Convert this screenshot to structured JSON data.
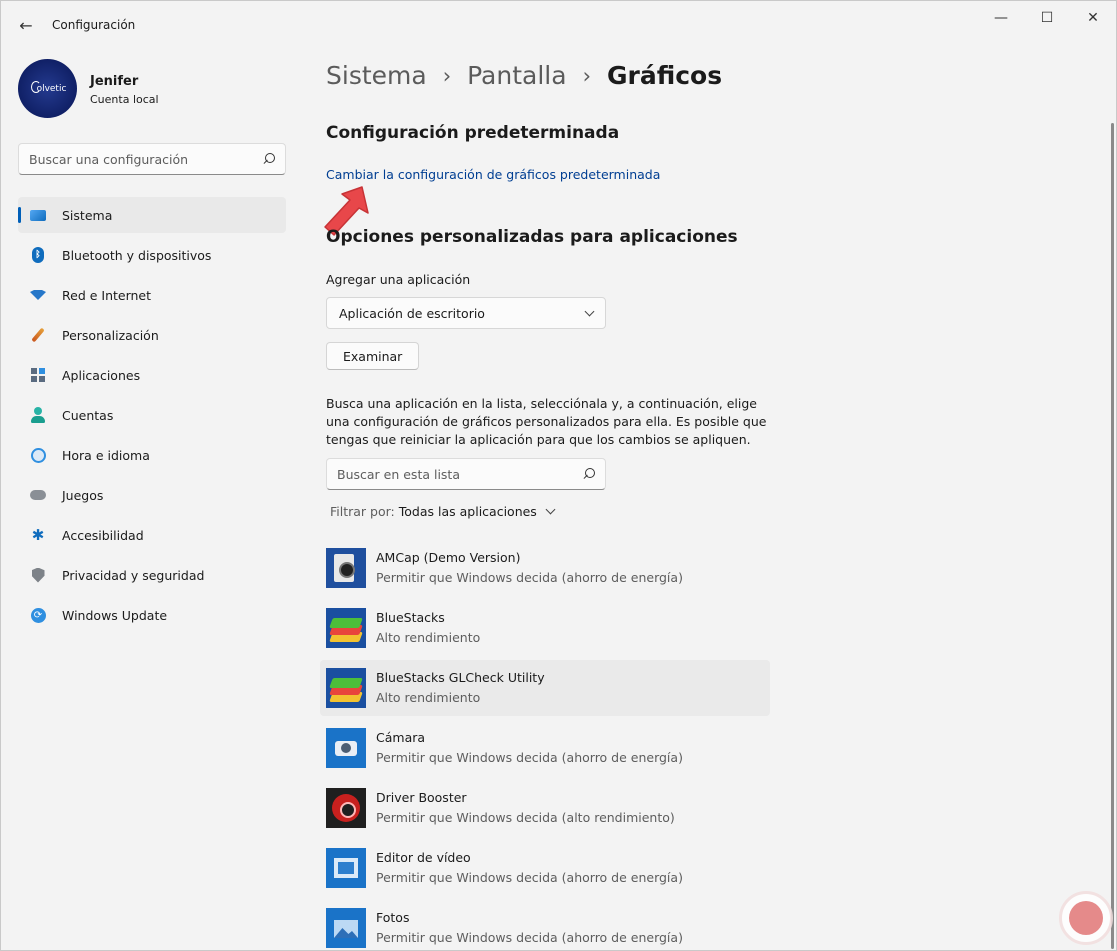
{
  "window": {
    "title": "Configuración",
    "back_icon": "arrow-left-icon",
    "controls": {
      "minimize": "—",
      "maximize": "☐",
      "close": "✕"
    }
  },
  "profile": {
    "name": "Jenifer",
    "subtitle": "Cuenta local",
    "avatar_text": "olvetic"
  },
  "sidebar": {
    "search_placeholder": "Buscar una configuración",
    "items": [
      {
        "label": "Sistema",
        "icon": "system-icon",
        "active": true
      },
      {
        "label": "Bluetooth y dispositivos",
        "icon": "bluetooth-icon"
      },
      {
        "label": "Red e Internet",
        "icon": "wifi-icon"
      },
      {
        "label": "Personalización",
        "icon": "brush-icon"
      },
      {
        "label": "Aplicaciones",
        "icon": "apps-icon"
      },
      {
        "label": "Cuentas",
        "icon": "user-icon"
      },
      {
        "label": "Hora e idioma",
        "icon": "clock-icon"
      },
      {
        "label": "Juegos",
        "icon": "gamepad-icon"
      },
      {
        "label": "Accesibilidad",
        "icon": "accessibility-icon"
      },
      {
        "label": "Privacidad y seguridad",
        "icon": "shield-icon"
      },
      {
        "label": "Windows Update",
        "icon": "update-icon"
      }
    ]
  },
  "breadcrumb": {
    "items": [
      "Sistema",
      "Pantalla"
    ],
    "separator": "›",
    "current": "Gráficos"
  },
  "main": {
    "default_section_title": "Configuración predeterminada",
    "default_link": "Cambiar la configuración de gráficos predeterminada",
    "custom_section_title": "Opciones personalizadas para aplicaciones",
    "add_app_label": "Agregar una aplicación",
    "app_type_value": "Aplicación de escritorio",
    "browse_button": "Examinar",
    "description": "Busca una aplicación en la lista, selecciónala y, a continuación, elige una configuración de gráficos personalizados para ella. Es posible que tengas que reiniciar la aplicación para que los cambios se apliquen.",
    "list_search_placeholder": "Buscar en esta lista",
    "filter_label": "Filtrar por:",
    "filter_value": "Todas las aplicaciones"
  },
  "apps": [
    {
      "name": "AMCap (Demo Version)",
      "mode": "Permitir que Windows decida (ahorro de energía)",
      "icon": "amcap-icon"
    },
    {
      "name": "BlueStacks",
      "mode": "Alto rendimiento",
      "icon": "bluestacks-icon"
    },
    {
      "name": "BlueStacks GLCheck Utility",
      "mode": "Alto rendimiento",
      "icon": "bluestacks-glcheck-icon",
      "hover": true
    },
    {
      "name": "Cámara",
      "mode": "Permitir que Windows decida (ahorro de energía)",
      "icon": "camera-icon"
    },
    {
      "name": "Driver Booster",
      "mode": "Permitir que Windows decida (alto rendimiento)",
      "icon": "driver-booster-icon"
    },
    {
      "name": "Editor de vídeo",
      "mode": "Permitir que Windows decida (ahorro de energía)",
      "icon": "video-editor-icon"
    },
    {
      "name": "Fotos",
      "mode": "Permitir que Windows decida (ahorro de energía)",
      "icon": "photos-icon"
    }
  ],
  "colors": {
    "accent": "#005fb8",
    "link": "#003e92",
    "annotation_arrow": "#e8474a"
  }
}
